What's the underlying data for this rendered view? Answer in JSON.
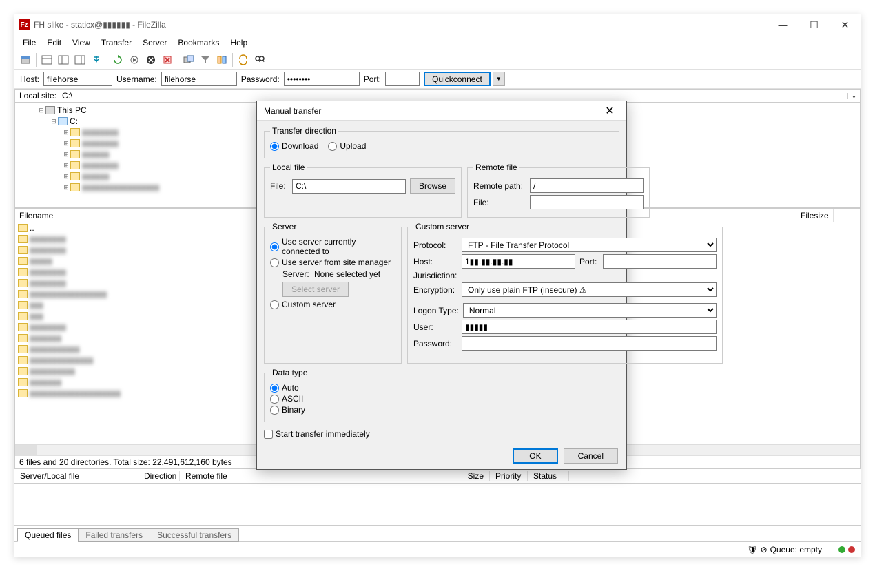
{
  "title": "FH slike - staticx@▮▮▮▮▮▮ - FileZilla",
  "menubar": [
    "File",
    "Edit",
    "View",
    "Transfer",
    "Server",
    "Bookmarks",
    "Help"
  ],
  "quickconnect": {
    "host_label": "Host:",
    "host": "filehorse",
    "user_label": "Username:",
    "user": "filehorse",
    "pass_label": "Password:",
    "pass": "••••••••",
    "port_label": "Port:",
    "port": "",
    "button": "Quickconnect"
  },
  "local_site": {
    "label": "Local site:",
    "value": "C:\\"
  },
  "tree": {
    "root": "This PC",
    "drive": "C:",
    "folders": [
      "▮▮▮▮▮▮▮▮",
      "▮▮▮▮▮▮▮▮",
      "▮▮▮▮▮▮",
      "▮▮▮▮▮▮▮▮",
      "▮▮▮▮▮▮",
      "▮▮▮▮▮▮▮▮▮▮▮▮▮▮▮▮▮"
    ]
  },
  "list": {
    "header_filename": "Filename",
    "header_filesize": "Filesize",
    "parent": "..",
    "items": [
      "▮▮▮▮▮▮▮▮",
      "▮▮▮▮▮▮▮▮",
      "▮▮▮▮▮",
      "▮▮▮▮▮▮▮▮",
      "▮▮▮▮▮▮▮▮",
      "▮▮▮▮▮▮▮▮▮▮▮▮▮▮▮▮▮",
      "▮▮▮",
      "▮▮▮",
      "▮▮▮▮▮▮▮▮",
      "▮▮▮▮▮▮▮",
      "▮▮▮▮▮▮▮▮▮▮▮",
      "▮▮▮▮▮▮▮▮▮▮▮▮▮▮",
      "▮▮▮▮▮▮▮▮▮▮",
      "▮▮▮▮▮▮▮",
      "▮▮▮▮▮▮▮▮▮▮▮▮▮▮▮▮▮▮▮▮"
    ],
    "status": "6 files and 20 directories. Total size: 22,491,612,160 bytes"
  },
  "queue": {
    "cols": [
      "Server/Local file",
      "Direction",
      "Remote file",
      "Size",
      "Priority",
      "Status"
    ]
  },
  "tabs": [
    "Queued files",
    "Failed transfers",
    "Successful transfers"
  ],
  "statusbar": {
    "queue": "Queue: empty"
  },
  "dialog": {
    "title": "Manual transfer",
    "transfer_direction": {
      "legend": "Transfer direction",
      "download": "Download",
      "upload": "Upload"
    },
    "local_file": {
      "legend": "Local file",
      "file_label": "File:",
      "file": "C:\\",
      "browse": "Browse"
    },
    "remote_file": {
      "legend": "Remote file",
      "path_label": "Remote path:",
      "path": "/",
      "file_label": "File:",
      "file": ""
    },
    "server": {
      "legend": "Server",
      "opt1": "Use server currently connected to",
      "opt2": "Use server from site manager",
      "server_label": "Server:",
      "server_value": "None selected yet",
      "select_server": "Select server",
      "opt3": "Custom server"
    },
    "custom": {
      "legend": "Custom server",
      "protocol_label": "Protocol:",
      "protocol": "FTP - File Transfer Protocol",
      "host_label": "Host:",
      "host": "1▮▮.▮▮.▮▮.▮▮",
      "port_label": "Port:",
      "port": "",
      "jurisdiction_label": "Jurisdiction:",
      "encryption_label": "Encryption:",
      "encryption": "Only use plain FTP (insecure) ⚠",
      "logon_label": "Logon Type:",
      "logon": "Normal",
      "user_label": "User:",
      "user": "▮▮▮▮▮",
      "password_label": "Password:",
      "password": ""
    },
    "data_type": {
      "legend": "Data type",
      "auto": "Auto",
      "ascii": "ASCII",
      "binary": "Binary"
    },
    "immediate": "Start transfer immediately",
    "ok": "OK",
    "cancel": "Cancel"
  }
}
